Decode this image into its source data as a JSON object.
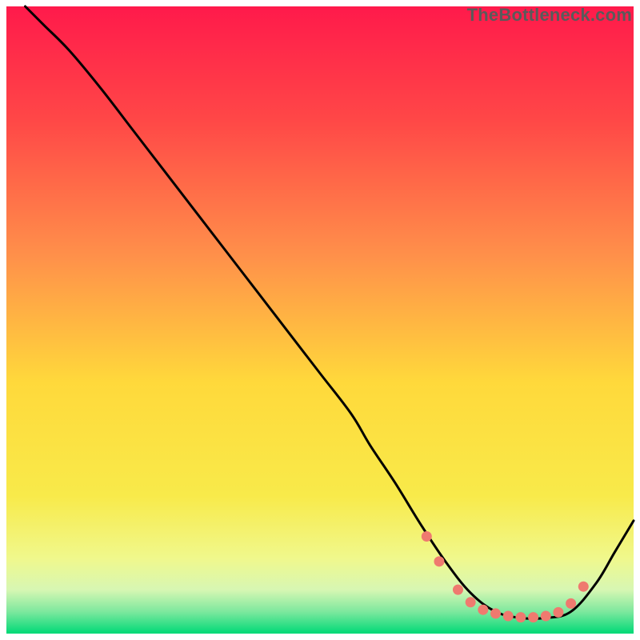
{
  "watermark": "TheBottleneck.com",
  "chart_data": {
    "type": "line",
    "title": "",
    "xlabel": "",
    "ylabel": "",
    "xlim": [
      0,
      100
    ],
    "ylim": [
      0,
      100
    ],
    "background_gradient": {
      "stops": [
        {
          "offset": 0.0,
          "color": "#ff1a4b"
        },
        {
          "offset": 0.18,
          "color": "#ff4747"
        },
        {
          "offset": 0.4,
          "color": "#ff914a"
        },
        {
          "offset": 0.6,
          "color": "#ffd93b"
        },
        {
          "offset": 0.78,
          "color": "#f8ea4a"
        },
        {
          "offset": 0.88,
          "color": "#f0f88c"
        },
        {
          "offset": 0.93,
          "color": "#d7f7b3"
        },
        {
          "offset": 0.965,
          "color": "#7de89e"
        },
        {
          "offset": 1.0,
          "color": "#00d977"
        }
      ]
    },
    "series": [
      {
        "name": "bottleneck-curve",
        "type": "line",
        "color": "#000000",
        "x": [
          3,
          6,
          10,
          15,
          20,
          25,
          30,
          35,
          40,
          45,
          50,
          55,
          58,
          62,
          66,
          70,
          74,
          78,
          82,
          86,
          90,
          94,
          97,
          100
        ],
        "y": [
          100,
          97,
          93,
          87,
          80.5,
          74,
          67.5,
          61,
          54.5,
          48,
          41.5,
          35,
          30,
          24,
          17.5,
          11.5,
          6.5,
          3.5,
          2.5,
          2.5,
          3.5,
          8,
          13,
          18
        ]
      },
      {
        "name": "optimal-zone-markers",
        "type": "scatter",
        "color": "#ef7a6f",
        "x": [
          67,
          69,
          72,
          74,
          76,
          78,
          80,
          82,
          84,
          86,
          88,
          90,
          92
        ],
        "y": [
          15.5,
          11.5,
          7,
          5,
          3.8,
          3.2,
          2.8,
          2.6,
          2.6,
          2.8,
          3.4,
          4.8,
          7.5
        ]
      }
    ]
  }
}
